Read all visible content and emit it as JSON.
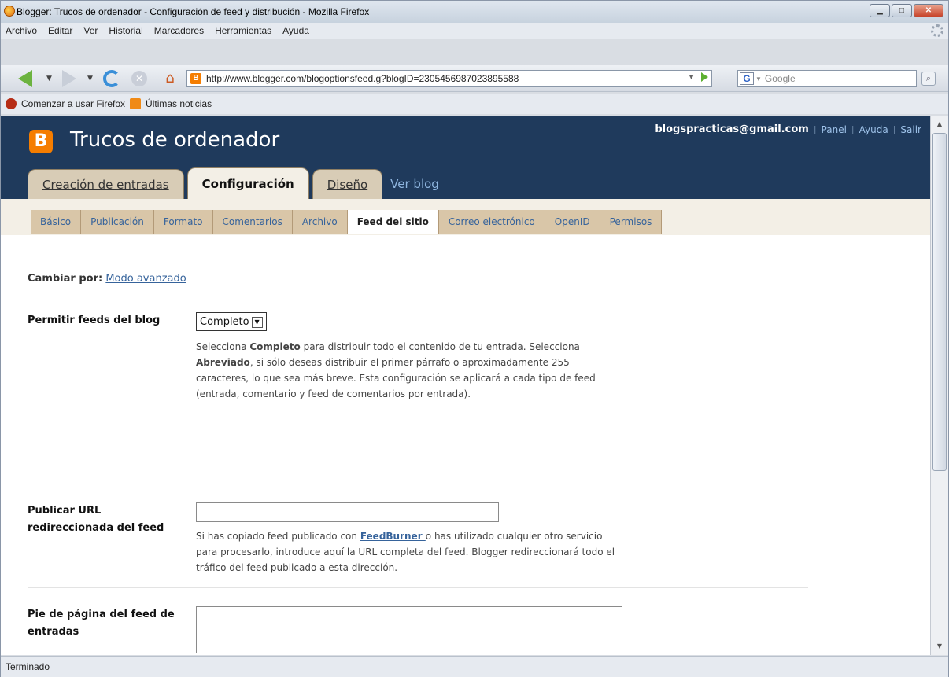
{
  "window": {
    "title": "Blogger: Trucos de ordenador - Configuración de feed y distribución - Mozilla Firefox"
  },
  "menu": [
    "Archivo",
    "Editar",
    "Ver",
    "Historial",
    "Marcadores",
    "Herramientas",
    "Ayuda"
  ],
  "nav": {
    "url": "http://www.blogger.com/blogoptionsfeed.g?blogID=2305456987023895588",
    "search_placeholder": "Google"
  },
  "bookmarks": [
    "Comenzar a usar Firefox",
    "Últimas noticias"
  ],
  "blog": {
    "title": "Trucos de ordenador",
    "logo_letter": "B",
    "user_email": "blogspracticas@gmail.com",
    "links": [
      "Panel",
      "Ayuda",
      "Salir"
    ]
  },
  "tabs": [
    "Creación de entradas",
    "Configuración",
    "Diseño",
    "Ver blog"
  ],
  "subtabs": [
    "Básico",
    "Publicación",
    "Formato",
    "Comentarios",
    "Archivo",
    "Feed del sitio",
    "Correo electrónico",
    "OpenID",
    "Permisos"
  ],
  "main": {
    "switch_label": "Cambiar por:",
    "switch_link": "Modo avanzado",
    "feeds_label": "Permitir feeds del blog",
    "feeds_value": "Completo",
    "feeds_help": {
      "p1": "Selecciona ",
      "b1": "Completo",
      "p2": " para distribuir todo el contenido de tu entrada. Selecciona ",
      "b2": "Abreviado",
      "p3": ", si sólo deseas distribuir el primer párrafo o aproximadamente 255 caracteres, lo que sea más breve. Esta configuración se aplicará a cada tipo de feed (entrada, comentario y feed de comentarios por entrada)."
    },
    "redirect_label": "Publicar URL redireccionada del feed",
    "redirect_value": "",
    "redirect_help": {
      "p1": "Si has copiado feed publicado con ",
      "link": "FeedBurner ",
      "p2": "o has utilizado cualquier otro servicio para procesarlo, introduce aquí la URL completa del feed. Blogger redireccionará todo el tráfico del feed publicado a esta dirección."
    },
    "footer_label": "Pie de página del feed de entradas",
    "footer_value": ""
  },
  "status": "Terminado"
}
